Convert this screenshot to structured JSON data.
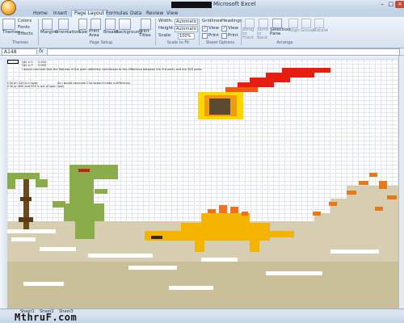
{
  "window": {
    "title": "Microsoft Excel",
    "controls": [
      "–",
      "□",
      "×"
    ]
  },
  "ribbon_tabs": [
    {
      "label": "Home",
      "active": false
    },
    {
      "label": "Insert",
      "active": false
    },
    {
      "label": "Page Layout",
      "active": true
    },
    {
      "label": "Formulas",
      "active": false
    },
    {
      "label": "Data",
      "active": false
    },
    {
      "label": "Review",
      "active": false
    },
    {
      "label": "View",
      "active": false
    }
  ],
  "ribbon": {
    "themes": {
      "button": "Themes",
      "colors": "Colors",
      "fonts": "Fonts",
      "effects": "Effects",
      "group": "Themes"
    },
    "page_setup": {
      "margins": "Margins",
      "orientation": "Orientation",
      "size": "Size",
      "print_area": "Print Area",
      "breaks": "Breaks",
      "background": "Background",
      "print_titles": "Print Titles",
      "group": "Page Setup"
    },
    "scale_to_fit": {
      "width_label": "Width:",
      "width_value": "Automatic",
      "height_label": "Height:",
      "height_value": "Automatic",
      "scale_label": "Scale:",
      "scale_value": "100%",
      "group": "Scale to Fit"
    },
    "sheet_options": {
      "gridlines": "Gridlines",
      "headings": "Headings",
      "view": "View",
      "print": "Print",
      "group": "Sheet Options"
    },
    "arrange": {
      "bring_to_front": "Bring to Front",
      "send_to_back": "Send to Back",
      "selection_pane": "Selection Pane",
      "align": "Align",
      "group_btn": "Group",
      "rotate": "Rotate",
      "group": "Arrange"
    }
  },
  "formula_bar": {
    "name_box": "A148",
    "fx": "fx",
    "content": ""
  },
  "sheet_text": {
    "row1a": "Qty ≤ 0",
    "row1b": "0.000",
    "row2a": "Qty ≥ 0",
    "row2b": "0.000",
    "note1": "I would conclude that the flatness of the plain definitely contributes to the difference between the 3rd party and the 3SD parts.",
    "note2": "C3A on 343 is in spec",
    "note3": "C3A on 890 and 993 is out of spec (low)",
    "note4": "So I would conclude C3A doesn't make a difference."
  },
  "sheet_tabs": [
    "Sheet1",
    "Sheet2",
    "Sheet3"
  ],
  "watermark": "MthruF.com",
  "colors": {
    "grass": "#c7c28f",
    "sand": "#d7ceb2",
    "dino_green": "#8aac4a",
    "stego": "#f4b400",
    "volcano": "#e87a16",
    "meteor": "#e81c10",
    "palm": "#6b4a18"
  }
}
